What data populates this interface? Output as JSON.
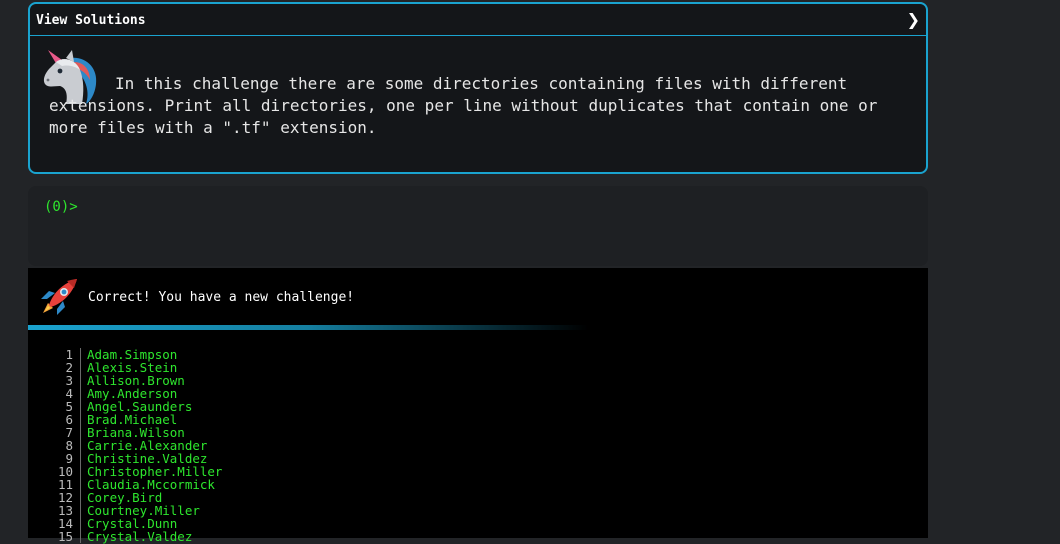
{
  "challenge": {
    "header_title": "View Solutions",
    "chevron_glyph": "❯",
    "description": "In this challenge there are some directories containing files with different extensions. Print all directories, one per line without duplicates that contain one or more files with a \".tf\" extension.",
    "mascot_icon": "unicorn-icon"
  },
  "terminal": {
    "prompt": "(0)>",
    "input_value": ""
  },
  "result": {
    "status_icon": "rocket-icon",
    "status_text": "Correct! You have a new challenge!",
    "accent_color": "#1aa3cf",
    "list_color": "#2ee62e",
    "lines": [
      {
        "num": "1",
        "text": "Adam.Simpson"
      },
      {
        "num": "2",
        "text": "Alexis.Stein"
      },
      {
        "num": "3",
        "text": "Allison.Brown"
      },
      {
        "num": "4",
        "text": "Amy.Anderson"
      },
      {
        "num": "5",
        "text": "Angel.Saunders"
      },
      {
        "num": "6",
        "text": "Brad.Michael"
      },
      {
        "num": "7",
        "text": "Briana.Wilson"
      },
      {
        "num": "8",
        "text": "Carrie.Alexander"
      },
      {
        "num": "9",
        "text": "Christine.Valdez"
      },
      {
        "num": "10",
        "text": "Christopher.Miller"
      },
      {
        "num": "11",
        "text": "Claudia.Mccormick"
      },
      {
        "num": "12",
        "text": "Corey.Bird"
      },
      {
        "num": "13",
        "text": "Courtney.Miller"
      },
      {
        "num": "14",
        "text": "Crystal.Dunn"
      },
      {
        "num": "15",
        "text": "Crystal.Valdez"
      }
    ]
  }
}
